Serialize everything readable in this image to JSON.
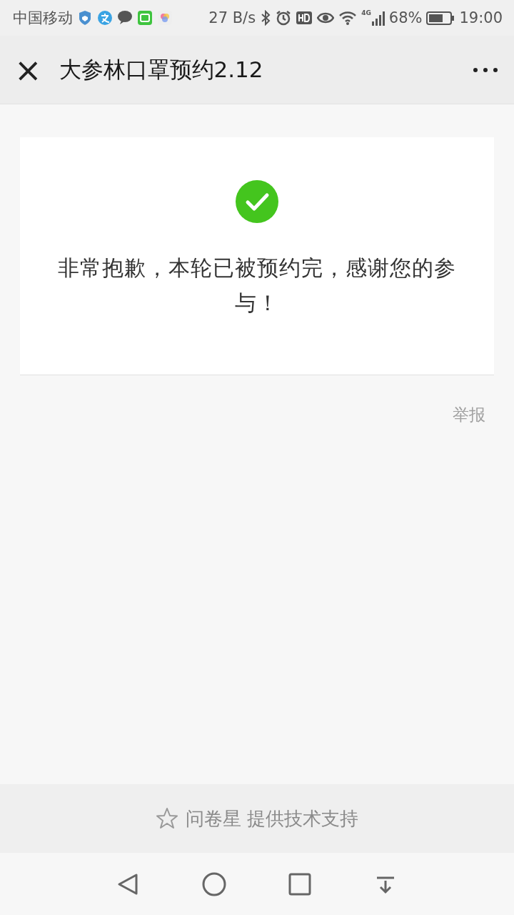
{
  "status_bar": {
    "carrier": "中国移动",
    "speed": "27 B/s",
    "network": "4G",
    "battery": "68%",
    "time": "19:00"
  },
  "header": {
    "close": "×",
    "title": "大参林口罩预约2.12"
  },
  "result": {
    "kind": "success",
    "message": "非常抱歉，本轮已被预约完，感谢您的参与！"
  },
  "report_link": "举报",
  "footer": {
    "text": "问卷星 提供技术支持"
  }
}
